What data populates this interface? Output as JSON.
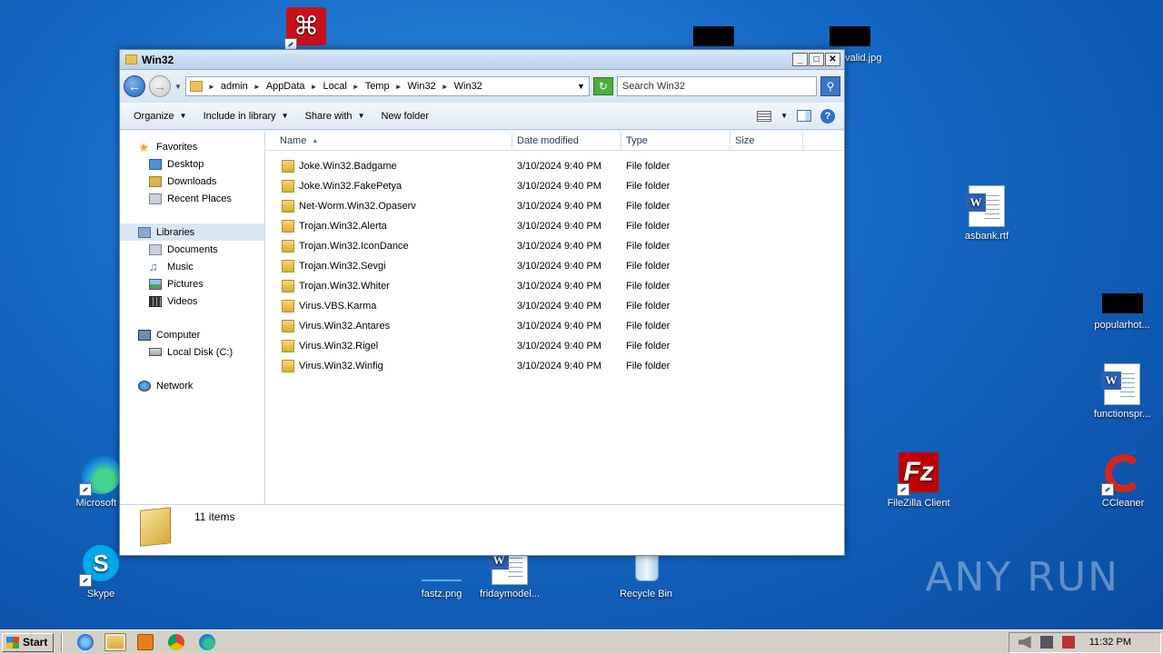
{
  "desktop": {
    "icons": [
      {
        "label": "",
        "glyph": "pdf-icon"
      },
      {
        "label": "valid.jpg",
        "glyph": "image-icon"
      },
      {
        "label": "asbank.rtf",
        "glyph": "word-document-icon"
      },
      {
        "label": "popularhot...",
        "glyph": "image-icon"
      },
      {
        "label": "functionspr...",
        "glyph": "word-document-icon"
      },
      {
        "label": "Microsoft E",
        "glyph": "edge-icon"
      },
      {
        "label": "FileZilla Client",
        "glyph": "filezilla-icon"
      },
      {
        "label": "CCleaner",
        "glyph": "ccleaner-icon"
      },
      {
        "label": "Skype",
        "glyph": "skype-icon"
      },
      {
        "label": "fastz.png",
        "glyph": "image-icon"
      },
      {
        "label": "fridaymodel...",
        "glyph": "word-document-icon"
      },
      {
        "label": "Recycle Bin",
        "glyph": "recycle-bin-icon"
      }
    ],
    "watermark": "ANY RUN"
  },
  "window": {
    "title": "Win32",
    "controls": {
      "minimize": "_",
      "maximize": "□",
      "close": "✕"
    },
    "address": {
      "crumbs": [
        "admin",
        "AppData",
        "Local",
        "Temp",
        "Win32",
        "Win32"
      ]
    },
    "search": {
      "placeholder": "Search Win32"
    },
    "toolbar": {
      "organize": "Organize",
      "include_in_library": "Include in library",
      "share_with": "Share with",
      "new_folder": "New folder"
    },
    "nav": {
      "favorites": "Favorites",
      "favorites_items": [
        "Desktop",
        "Downloads",
        "Recent Places"
      ],
      "libraries": "Libraries",
      "libraries_items": [
        "Documents",
        "Music",
        "Pictures",
        "Videos"
      ],
      "computer": "Computer",
      "computer_items": [
        "Local Disk (C:)"
      ],
      "network": "Network"
    },
    "columns": {
      "name": "Name",
      "date": "Date modified",
      "type": "Type",
      "size": "Size"
    },
    "files": [
      {
        "name": "Joke.Win32.Badgame",
        "date": "3/10/2024 9:40 PM",
        "type": "File folder"
      },
      {
        "name": "Joke.Win32.FakePetya",
        "date": "3/10/2024 9:40 PM",
        "type": "File folder"
      },
      {
        "name": "Net-Worm.Win32.Opaserv",
        "date": "3/10/2024 9:40 PM",
        "type": "File folder"
      },
      {
        "name": "Trojan.Win32.Alerta",
        "date": "3/10/2024 9:40 PM",
        "type": "File folder"
      },
      {
        "name": "Trojan.Win32.IconDance",
        "date": "3/10/2024 9:40 PM",
        "type": "File folder"
      },
      {
        "name": "Trojan.Win32.Sevgi",
        "date": "3/10/2024 9:40 PM",
        "type": "File folder"
      },
      {
        "name": "Trojan.Win32.Whiter",
        "date": "3/10/2024 9:40 PM",
        "type": "File folder"
      },
      {
        "name": "Virus.VBS.Karma",
        "date": "3/10/2024 9:40 PM",
        "type": "File folder"
      },
      {
        "name": "Virus.Win32.Antares",
        "date": "3/10/2024 9:40 PM",
        "type": "File folder"
      },
      {
        "name": "Virus.Win32.Rigel",
        "date": "3/10/2024 9:40 PM",
        "type": "File folder"
      },
      {
        "name": "Virus.Win32.Winfig",
        "date": "3/10/2024 9:40 PM",
        "type": "File folder"
      }
    ],
    "status": {
      "item_count": "11 items"
    }
  },
  "taskbar": {
    "start_label": "Start",
    "pinned": [
      "internet-explorer-icon",
      "explorer-icon",
      "media-player-icon",
      "chrome-icon",
      "edge-icon"
    ],
    "clock": "11:32 PM"
  }
}
